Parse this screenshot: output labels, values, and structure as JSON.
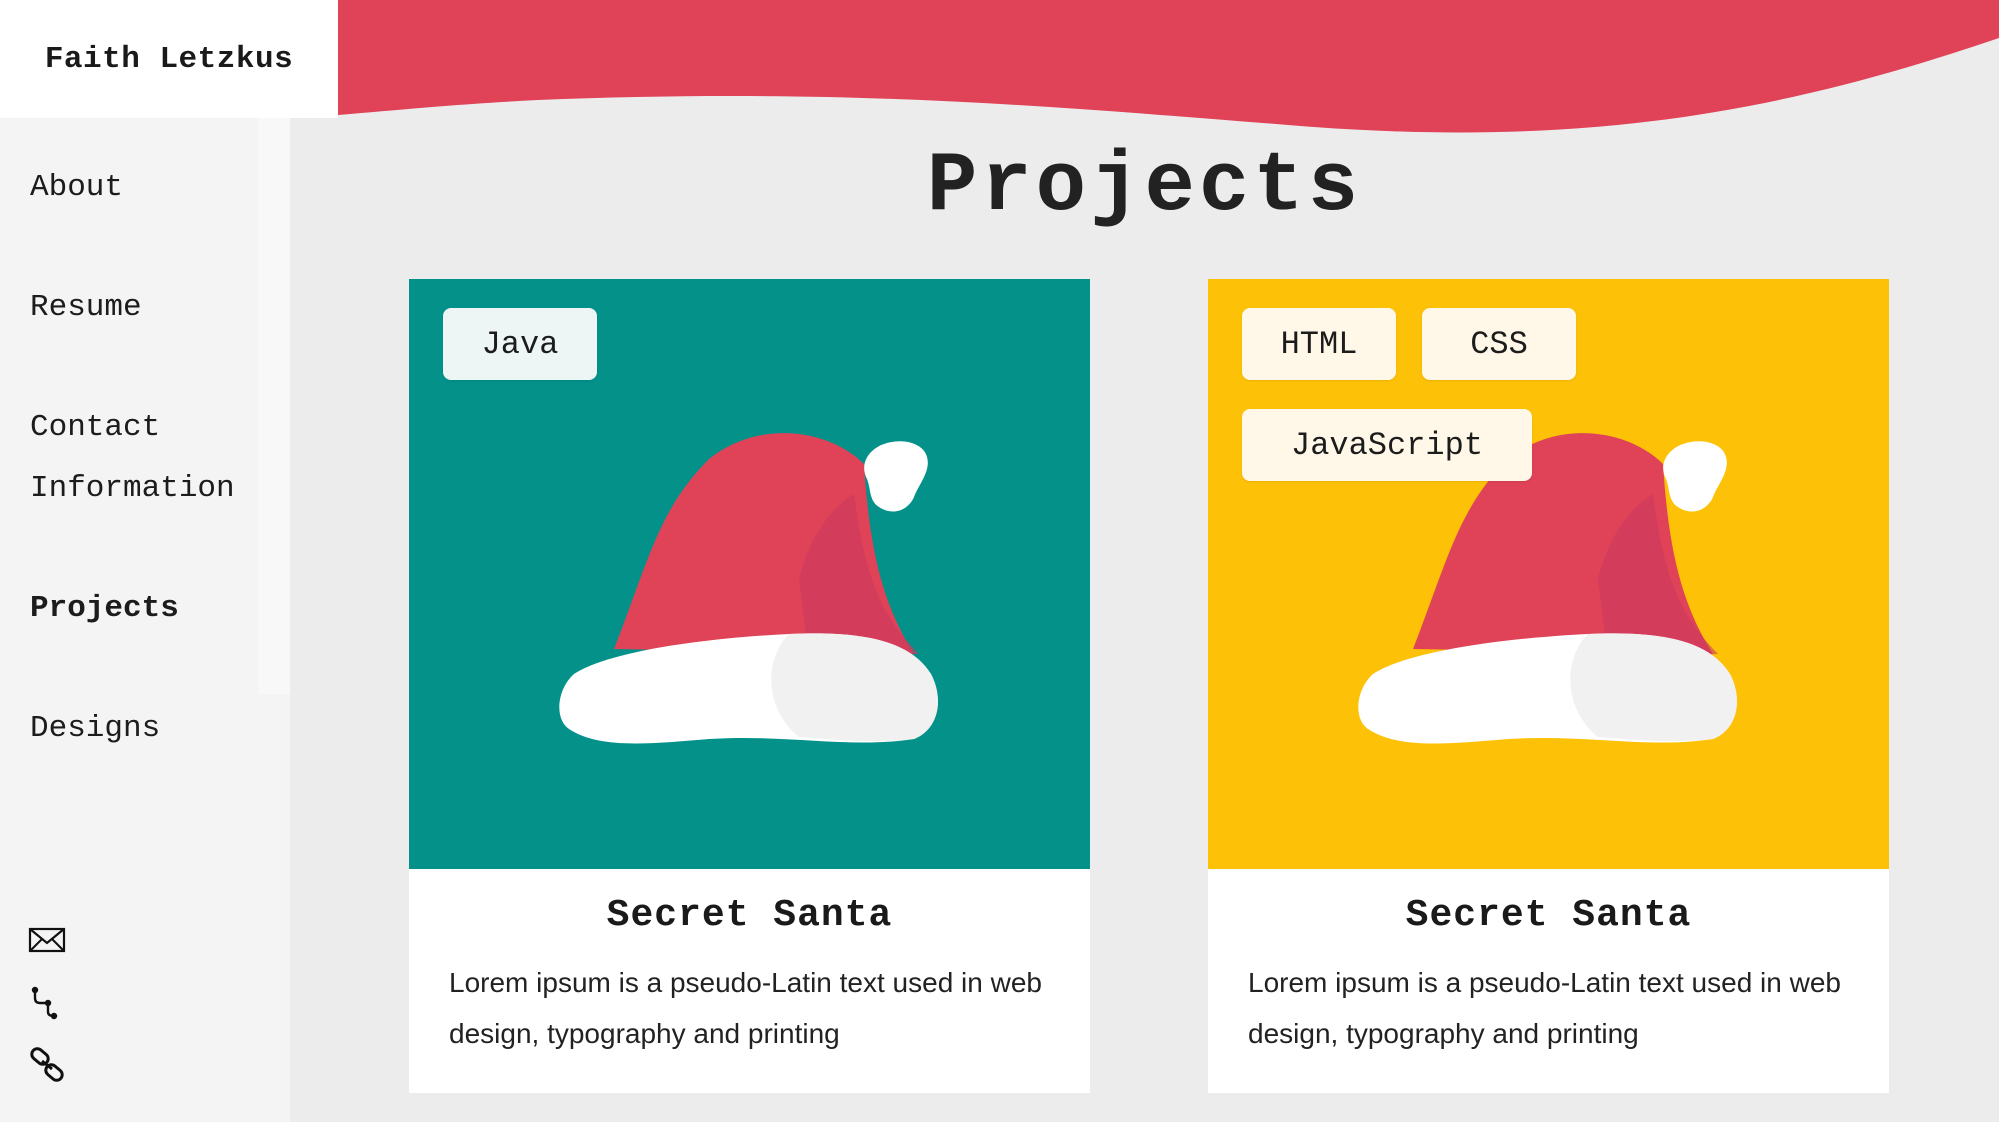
{
  "brand": {
    "name": "Faith Letzkus"
  },
  "colors": {
    "accent": "#e04257",
    "teal": "#03918a",
    "yellow": "#fdc107",
    "hat_red": "#e04257",
    "hat_white": "#ffffff"
  },
  "nav": {
    "items": [
      {
        "label": "About"
      },
      {
        "label": "Resume"
      },
      {
        "label": "Contact"
      },
      {
        "label": "Information"
      },
      {
        "label": "Projects",
        "active": true
      },
      {
        "label": "Designs"
      }
    ]
  },
  "social": {
    "icons": [
      "mail-icon",
      "git-icon",
      "link-icon"
    ]
  },
  "page": {
    "title": "Projects"
  },
  "cards": [
    {
      "tags": [
        "Java"
      ],
      "image_bg": "#03918a",
      "title": "Secret Santa",
      "description": "Lorem ipsum is a pseudo-Latin text used in web design, typography and printing"
    },
    {
      "tags": [
        "HTML",
        "CSS",
        "JavaScript"
      ],
      "image_bg": "#fdc107",
      "title": "Secret Santa",
      "description": "Lorem ipsum is a pseudo-Latin text used in web design, typography and printing"
    }
  ]
}
